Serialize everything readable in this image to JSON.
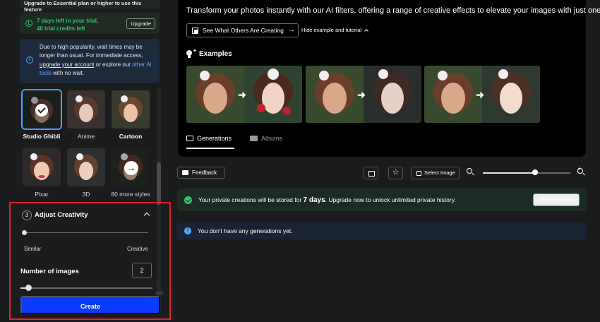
{
  "sidebar": {
    "upgrade_strip": "Upgrade to Essential plan or higher to use this feature",
    "trial": {
      "line1": "7 days left in your trial,",
      "line2": "40 trial credits left",
      "button": "Upgrade"
    },
    "notice": {
      "text_before": "Due to high popularity, wait times may be longer than usual. For immediate access, ",
      "link_upgrade": "upgrade your account",
      "text_mid": " or explore our ",
      "link_other": "other AI tools",
      "text_after": " with no wait."
    },
    "styles": [
      {
        "label": "Studio Ghibli",
        "selected": true
      },
      {
        "label": "Anime",
        "selected": false
      },
      {
        "label": "Cartoon",
        "selected": false
      },
      {
        "label": "Pixar",
        "selected": false
      },
      {
        "label": "3D",
        "selected": false
      },
      {
        "label": "80 more styles",
        "selected": false
      }
    ],
    "creativity": {
      "step": "3",
      "title": "Adjust Creativity",
      "min_label": "Similar",
      "max_label": "Creative",
      "level": 0.0
    },
    "images": {
      "label": "Number of images",
      "value": "2",
      "slider_level": 0.06
    },
    "create_button": "Create"
  },
  "main": {
    "description": "Transform your photos instantly with our AI filters, offering a range of creative effects to elevate your images with just one tap.",
    "see_button": "See What Others Are Creating",
    "hide_link": "Hide example and tutorial",
    "examples_title": "Examples",
    "tabs": [
      {
        "label": "Generations",
        "active": true
      },
      {
        "label": "Albums",
        "active": false
      }
    ],
    "feedback_button": "Feedback",
    "select_image_button": "Select Image",
    "zoom_level": 0.6,
    "private_banner": {
      "before": "Your private creations will be stored for ",
      "highlight": "7 days",
      "after": ". Upgrade now to unlock unlimited private history.",
      "button": "Upgrade Now"
    },
    "empty_message": "You don't have any generations yet."
  },
  "colors": {
    "accent_blue": "#0a3cff",
    "success_green": "#35c46a",
    "highlight_red": "#e0202a",
    "info_blue": "#5aa7ff"
  }
}
